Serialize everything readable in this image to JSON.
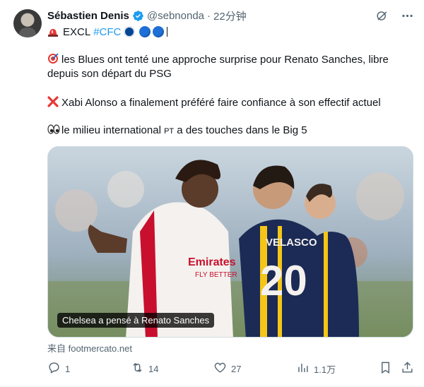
{
  "tweet": {
    "author_name": "Sébastien Denis",
    "handle": "@sebnonda",
    "separator": "·",
    "time": "22分钟",
    "bio": {
      "excl": "EXCL",
      "hashtag": "#CFC"
    },
    "paragraphs": {
      "p1": "les Blues ont tenté une approche surprise pour Renato Sanches, libre depuis son départ du PSG",
      "p2": "Xabi Alonso a finalement préféré faire confiance à son effectif actuel",
      "p3_before": "le milieu international ",
      "p3_pt": "PT",
      "p3_after": " a des touches dans le Big 5"
    },
    "media": {
      "caption": "Chelsea a pensé à Renato Sanches",
      "player_left_sponsor": "Emirates",
      "player_left_sponsor2": "FLY BETTER",
      "player_right_name": "VELASCO",
      "player_right_number": "20"
    },
    "source": "来自 footmercato.net"
  },
  "actions": {
    "reply_count": "1",
    "retweet_count": "14",
    "like_count": "27",
    "views_count": "1.1万"
  },
  "icons": {
    "verified": "verified-badge-icon",
    "grok": "grok-icon",
    "more": "more-icon",
    "reply": "reply-icon",
    "retweet": "retweet-icon",
    "like": "heart-icon",
    "views": "views-icon",
    "bookmark": "bookmark-icon",
    "share": "share-icon"
  },
  "colors": {
    "accent": "#1d9bf0",
    "text": "#0f1419",
    "muted": "#536471"
  }
}
